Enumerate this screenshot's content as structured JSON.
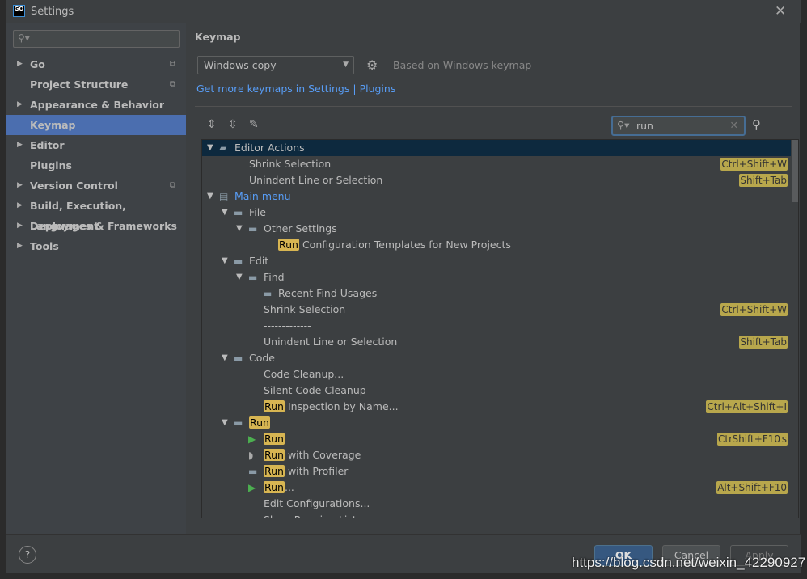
{
  "window": {
    "title": "Settings",
    "logo": "GO"
  },
  "sidebar": {
    "search_placeholder": "",
    "items": [
      {
        "label": "Go",
        "expandable": true,
        "copy": true
      },
      {
        "label": "Project Structure",
        "expandable": false,
        "copy": true
      },
      {
        "label": "Appearance & Behavior",
        "expandable": true,
        "copy": false
      },
      {
        "label": "Keymap",
        "expandable": false,
        "copy": false,
        "selected": true
      },
      {
        "label": "Editor",
        "expandable": true,
        "copy": false
      },
      {
        "label": "Plugins",
        "expandable": false,
        "copy": false
      },
      {
        "label": "Version Control",
        "expandable": true,
        "copy": true
      },
      {
        "label": "Build, Execution, Deployment",
        "expandable": true,
        "copy": false
      },
      {
        "label": "Languages & Frameworks",
        "expandable": true,
        "copy": false
      },
      {
        "label": "Tools",
        "expandable": true,
        "copy": false
      }
    ]
  },
  "keymap": {
    "title": "Keymap",
    "selected": "Windows copy",
    "based_on": "Based on Windows keymap",
    "link_settings": "Get more keymaps in Settings",
    "link_sep": " | ",
    "link_plugins": "Plugins",
    "search_value": "run",
    "tree": [
      {
        "level": 0,
        "arrow": true,
        "icon": "editor-actions",
        "text": "Editor Actions",
        "selected": true
      },
      {
        "level": 1,
        "text": "Shrink Selection",
        "shortcuts": [
          "Ctrl+Shift+W"
        ]
      },
      {
        "level": 1,
        "text": "Unindent Line or Selection",
        "shortcuts": [
          "Shift+Tab"
        ]
      },
      {
        "level": 0,
        "arrow": true,
        "icon": "menu",
        "text": "Main menu",
        "blue": true
      },
      {
        "level": 1,
        "arrow": true,
        "icon": "folder",
        "text": "File"
      },
      {
        "level": 2,
        "arrow": true,
        "icon": "folder",
        "text": "Other Settings"
      },
      {
        "level": 3,
        "hl": "Run",
        "text": " Configuration Templates for New Projects"
      },
      {
        "level": 1,
        "arrow": true,
        "icon": "folder",
        "text": "Edit"
      },
      {
        "level": 2,
        "arrow": true,
        "icon": "folder",
        "text": "Find"
      },
      {
        "level": 3,
        "icon": "folder",
        "text": "Recent Find Usages"
      },
      {
        "level": 2,
        "text": "Shrink Selection",
        "shortcuts": [
          "Ctrl+Shift+W"
        ]
      },
      {
        "level": 2,
        "text": "-------------"
      },
      {
        "level": 2,
        "text": "Unindent Line or Selection",
        "shortcuts": [
          "Shift+Tab"
        ]
      },
      {
        "level": 1,
        "arrow": true,
        "icon": "folder",
        "text": "Code"
      },
      {
        "level": 2,
        "text": "Code Cleanup..."
      },
      {
        "level": 2,
        "text": "Silent Code Cleanup"
      },
      {
        "level": 2,
        "hl": "Run",
        "text": " Inspection by Name...",
        "shortcuts": [
          "Ctrl+Alt+Shift+I"
        ]
      },
      {
        "level": 1,
        "arrow": true,
        "icon": "folder",
        "hl": "Run",
        "text": ""
      },
      {
        "level": 2,
        "icon": "play",
        "hl": "Run",
        "text": "",
        "shortcuts": [
          "Shift+F10",
          "Ctrl+Windows"
        ]
      },
      {
        "level": 2,
        "icon": "coverage",
        "hl": "Run",
        "text": " with Coverage"
      },
      {
        "level": 2,
        "icon": "folder",
        "hl": "Run",
        "text": " with Profiler"
      },
      {
        "level": 2,
        "icon": "play",
        "hl": "Run",
        "text": "...",
        "shortcuts": [
          "Alt+Shift+F10"
        ]
      },
      {
        "level": 2,
        "text": "Edit Configurations..."
      },
      {
        "level": 2,
        "text": "Show Running List"
      }
    ]
  },
  "footer": {
    "help": "?",
    "ok": "OK",
    "cancel": "Cancel",
    "apply": "Apply"
  },
  "watermark": "https://blog.csdn.net/weixin_42290927",
  "colors": {
    "selection": "#4b6eaf",
    "highlight": "#d7b552",
    "shortcut": "#b8a74c",
    "link": "#589df6"
  }
}
